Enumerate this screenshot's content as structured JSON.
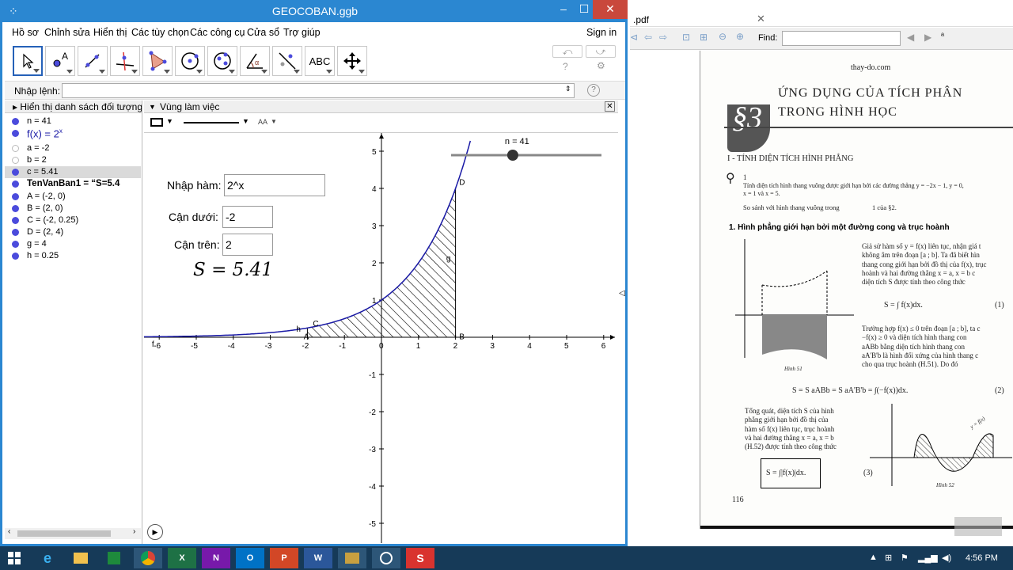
{
  "window": {
    "title": "GEOCOBAN.ggb",
    "signin": "Sign in",
    "minimize_glyph": "–",
    "maximize_glyph": "☐",
    "close_glyph": "✕"
  },
  "menu": [
    "Hồ sơ",
    "Chỉnh sửa",
    "Hiển thị",
    "Các tùy chọn",
    "Các công cụ",
    "Cửa sổ",
    "Trợ giúp"
  ],
  "toolbar": {
    "tools": [
      "move-tool",
      "point-tool",
      "line-tool",
      "perpendicular-tool",
      "polygon-tool",
      "circle-tool",
      "conic-tool",
      "angle-tool",
      "reflect-tool",
      "text-tool",
      "move-view-tool"
    ],
    "text_tool_label": "ABC"
  },
  "command": {
    "label": "Nhập lệnh:"
  },
  "algebra": {
    "header": "Hiển thị danh sách đối tượng",
    "items": [
      {
        "text": "n = 41",
        "on": true
      },
      {
        "text": "f(x) = 2",
        "sup": "x",
        "on": true
      },
      {
        "text": "a = -2",
        "on": false
      },
      {
        "text": "b = 2",
        "on": false
      },
      {
        "text": "c = 5.41",
        "on": true
      },
      {
        "text": "TenVanBan1 = “S=5.4",
        "on": true
      },
      {
        "text": "A = (-2, 0)",
        "on": true
      },
      {
        "text": "B = (2, 0)",
        "on": true
      },
      {
        "text": "C = (-2, 0.25)",
        "on": true
      },
      {
        "text": "D = (2, 4)",
        "on": true
      },
      {
        "text": "g = 4",
        "on": true
      },
      {
        "text": "h = 0.25",
        "on": true
      }
    ]
  },
  "graphics": {
    "header": "Vùng làm việc",
    "style_aa": "AA",
    "input_function_label": "Nhập hàm:",
    "input_function_value": "2^x",
    "lower_label": "Cận dưới:",
    "lower_value": "-2",
    "upper_label": "Cận trên:",
    "upper_value": "2",
    "area_text": "S = 5.41",
    "slider_label": "n = 41",
    "slider_fraction": 0.41,
    "axis": {
      "xmin": -6,
      "xmax": 6,
      "ymin": -5,
      "ymax": 5
    },
    "x_ticks": [
      "-6",
      "-5",
      "-4",
      "-3",
      "-2",
      "-1",
      "0",
      "1",
      "2",
      "3",
      "4",
      "5",
      "6"
    ],
    "y_ticks": [
      "5",
      "4",
      "3",
      "2",
      "1",
      "-1",
      "-2",
      "-3",
      "-4",
      "-5"
    ],
    "point_labels": {
      "A": "A",
      "B": "B",
      "C": "C",
      "D": "D",
      "g": "g",
      "h": "h",
      "f": "f"
    },
    "curve_color": "#1a1aa6"
  },
  "pdf": {
    "tab": ".pdf",
    "find_label": "Find:",
    "site": "thay-do.com",
    "chapter_mark": "§3",
    "heading1": "ỨNG DỤNG CỦA TÍCH PHÂN",
    "heading2": "TRONG HÌNH HỌC",
    "section": "I - TÍNH DIỆN TÍCH HÌNH PHẲNG",
    "exercise_num": "1",
    "exercise1": "Tính diện tích hình thang vuông được giới hạn bởi các đường thẳng y = −2x − 1, y = 0,",
    "exercise2": "x = 1 và x = 5.",
    "compare": "So sánh với hình thang vuông trong",
    "compare_ref": "1 của §2.",
    "sub1": "1.  Hình phẳng giới hạn bởi một đường cong và trục hoành",
    "para1": [
      "Giả sử hàm số y = f(x) liên tục, nhận giá t",
      "không âm trên đoạn [a ; b]. Ta đã biết hìn",
      "thang cong giới hạn bởi đồ thị của f(x), trục",
      "hoành và hai đường thẳng x = a, x = b c",
      "diện tích S được tính theo công thức"
    ],
    "formula1": "S = ∫ f(x)dx.",
    "formula1_num": "(1)",
    "para2": [
      "Trường hợp f(x) ≤ 0 trên đoạn [a ; b], ta c",
      "−f(x) ≥ 0 và diện tích hình thang con",
      "aABb bằng diện tích hình thang con",
      "aA'B'b là hình đối xứng của hình thang c",
      "cho qua trục hoành (H.51). Do đó"
    ],
    "fig51": "Hình 51",
    "formula2": "S = S aABb = S aA'B'b = ∫(−f(x))dx.",
    "formula2_num": "(2)",
    "para3": [
      "Tổng quát, diện tích S của hình",
      "phẳng giới hạn bởi đồ thị của",
      "hàm số f(x) liên tục, trục hoành",
      "và hai đường thẳng x = a, x = b",
      "(H.52) được tính theo công thức"
    ],
    "formula3": "S = ∫|f(x)|dx.",
    "formula3_num": "(3)",
    "fig52": "Hình 52",
    "yfx": "y = f(x)",
    "page_num": "116"
  },
  "taskbar": {
    "time": "4:56 PM",
    "apps": [
      "windows-start",
      "ie",
      "explorer",
      "spreadsheet",
      "chrome",
      "excel",
      "onenote",
      "outlook",
      "powerpoint",
      "word",
      "pdf",
      "geogebra",
      "snagit"
    ]
  }
}
